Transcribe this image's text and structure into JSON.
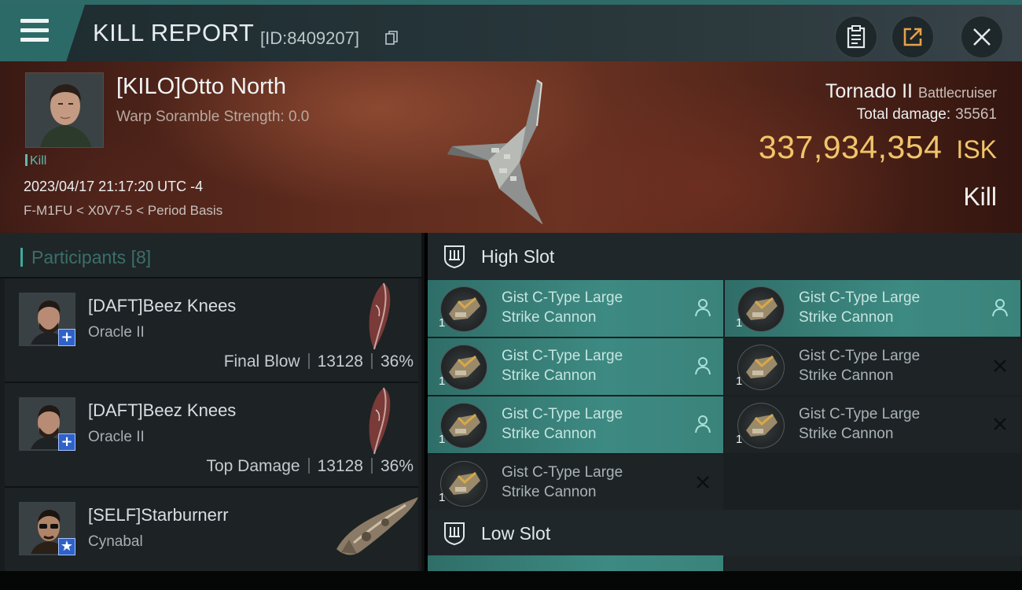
{
  "title_bar": {
    "title": "KILL REPORT",
    "id_text": "[ID:8409207]",
    "icons": [
      "menu-icon",
      "copy-icon",
      "clipboard-icon",
      "share-icon",
      "close-icon"
    ]
  },
  "victim": {
    "name": "[KILO]Otto North",
    "warp_text": "Warp Soramble Strength: 0.0",
    "tag": "Kill",
    "date": "2023/04/17 21:17:20 UTC -4",
    "location": "F-M1FU < X0V7-5 < Period Basis",
    "ship": "Tornado II",
    "ship_class": "Battlecruiser",
    "total_damage_label": "Total damage:",
    "total_damage": "35561",
    "isk_value": "337,934,354",
    "isk_unit": "ISK",
    "result": "Kill"
  },
  "participants": {
    "label": "Participants",
    "count": "[8]",
    "rows": [
      {
        "name": "[DAFT]Beez Knees",
        "ship": "Oracle II",
        "role": "Final Blow",
        "damage": "13128",
        "percent": "36%",
        "badge": "+"
      },
      {
        "name": "[DAFT]Beez Knees",
        "ship": "Oracle II",
        "role": "Top Damage",
        "damage": "13128",
        "percent": "36%",
        "badge": "+"
      },
      {
        "name": "[SELF]Starburnerr",
        "ship": "Cynabal",
        "role": "",
        "damage": "",
        "percent": "",
        "badge": "★"
      }
    ]
  },
  "fitting": {
    "high_slot_label": "High Slot",
    "low_slot_label": "Low Slot",
    "high_modules": [
      {
        "line1": "Gist C-Type Large",
        "line2": "Strike Cannon",
        "qty": "1",
        "state": "pilot"
      },
      {
        "line1": "Gist C-Type Large",
        "line2": "Strike Cannon",
        "qty": "1",
        "state": "pilot"
      },
      {
        "line1": "Gist C-Type Large",
        "line2": "Strike Cannon",
        "qty": "1",
        "state": "pilot"
      },
      {
        "line1": "Gist C-Type Large",
        "line2": "Strike Cannon",
        "qty": "1",
        "state": "destroyed"
      },
      {
        "line1": "Gist C-Type Large",
        "line2": "Strike Cannon",
        "qty": "1",
        "state": "pilot"
      },
      {
        "line1": "Gist C-Type Large",
        "line2": "Strike Cannon",
        "qty": "1",
        "state": "destroyed"
      },
      {
        "line1": "Gist C-Type Large",
        "line2": "Strike Cannon",
        "qty": "1",
        "state": "destroyed"
      }
    ]
  },
  "colors": {
    "accent": "#3d8a82",
    "isk": "#f1c46a",
    "badge_blue": "#2e62c8"
  }
}
